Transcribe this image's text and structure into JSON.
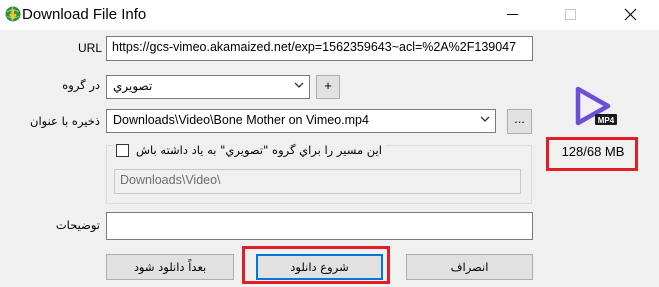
{
  "window": {
    "title": "Download File Info",
    "icons": {
      "app": "idm-globe-icon",
      "minimize": "minimize-icon",
      "maximize": "maximize-icon",
      "close": "close-icon"
    }
  },
  "form": {
    "url_label": "URL",
    "url_value": "https://gcs-vimeo.akamaized.net/exp=1562359643~acl=%2A%2F139047",
    "category_label": "در گروه",
    "category_value": "تصويري",
    "add_category_label": "+",
    "save_as_label": "ذخيره با عنوان",
    "save_as_value": "Downloads\\Video\\Bone Mother on Vimeo.mp4",
    "browse_label": "...",
    "remember_path_label": "اين مسير را براي گروه \"تصويري\" به ياد داشته باش",
    "remember_path_checked": false,
    "path_value": "Downloads\\Video\\",
    "description_label": "توضيحات",
    "description_value": ""
  },
  "file_info": {
    "icon": "mp4-video-icon",
    "icon_badge": "MP4",
    "size_text": "128/68  MB",
    "icon_color": "#6b4fd8"
  },
  "buttons": {
    "download_later": "بعداً دانلود شود",
    "start_download": "شروع دانلود",
    "cancel": "انصراف"
  },
  "colors": {
    "highlight": "#e31d26",
    "focus_border": "#0078d7"
  }
}
